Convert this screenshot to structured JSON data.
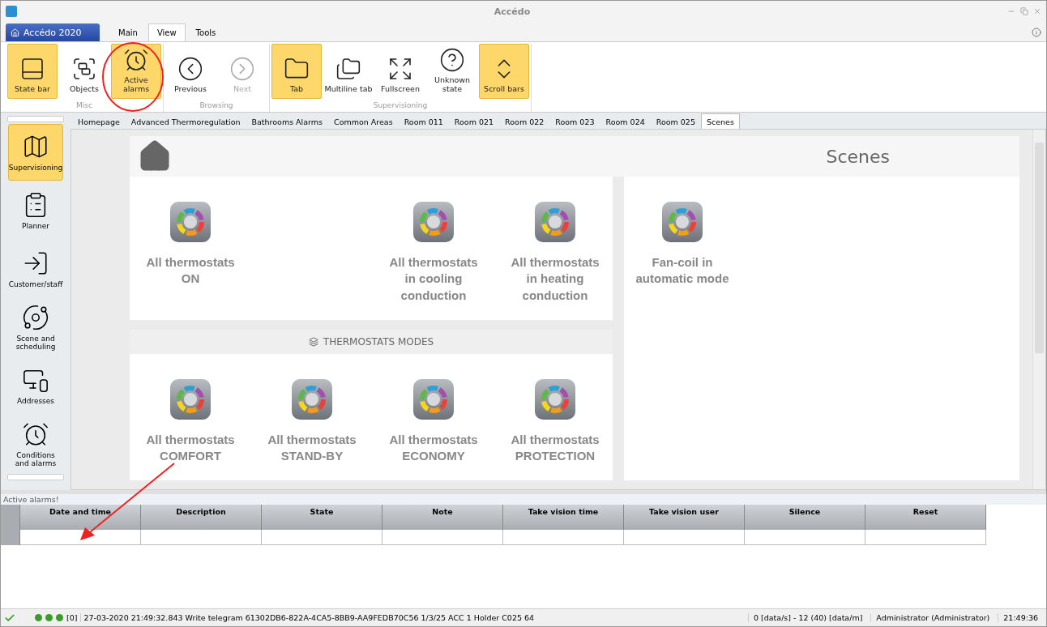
{
  "window": {
    "title": "Accédo"
  },
  "app_menu": {
    "label": "Accédo 2020"
  },
  "ribbon_tabs": [
    {
      "label": "Main",
      "selected": false
    },
    {
      "label": "View",
      "selected": true
    },
    {
      "label": "Tools",
      "selected": false
    }
  ],
  "ribbon_groups": [
    {
      "label": "Misc",
      "buttons": [
        {
          "label": "State bar",
          "selected": true,
          "disabled": false
        },
        {
          "label": "Objects",
          "selected": false,
          "disabled": false
        },
        {
          "label": "Active alarms",
          "selected": true,
          "disabled": false
        }
      ]
    },
    {
      "label": "Browsing",
      "buttons": [
        {
          "label": "Previous",
          "selected": false,
          "disabled": false
        },
        {
          "label": "Next",
          "selected": false,
          "disabled": true
        }
      ]
    },
    {
      "label": "Supervisioning",
      "buttons": [
        {
          "label": "Tab",
          "selected": true,
          "disabled": false
        },
        {
          "label": "Multiline tab",
          "selected": false,
          "disabled": false
        },
        {
          "label": "Fullscreen",
          "selected": false,
          "disabled": false
        },
        {
          "label": "Unknown state",
          "selected": false,
          "disabled": false
        },
        {
          "label": "Scroll bars",
          "selected": true,
          "disabled": false
        }
      ]
    }
  ],
  "sidebar": {
    "items": [
      {
        "label": "Supervisioning",
        "selected": true
      },
      {
        "label": "Planner",
        "selected": false
      },
      {
        "label": "Customer/staff",
        "selected": false
      },
      {
        "label": "Scene and scheduling",
        "selected": false
      },
      {
        "label": "Addresses",
        "selected": false
      },
      {
        "label": "Conditions and alarms",
        "selected": false
      }
    ]
  },
  "doc_tabs": [
    {
      "label": "Homepage",
      "selected": false
    },
    {
      "label": "Advanced Thermoregulation",
      "selected": false
    },
    {
      "label": "Bathrooms Alarms",
      "selected": false
    },
    {
      "label": "Common Areas",
      "selected": false
    },
    {
      "label": "Room 011",
      "selected": false
    },
    {
      "label": "Room 021",
      "selected": false
    },
    {
      "label": "Room 022",
      "selected": false
    },
    {
      "label": "Room 023",
      "selected": false
    },
    {
      "label": "Room 024",
      "selected": false
    },
    {
      "label": "Room 025",
      "selected": false
    },
    {
      "label": "Scenes",
      "selected": true
    }
  ],
  "page": {
    "title": "Scenes",
    "top_scenes": [
      {
        "kind": "scene",
        "label": "All thermostats ON"
      },
      {
        "kind": "blank"
      },
      {
        "kind": "scene",
        "label": "All thermostats in cooling conduction"
      },
      {
        "kind": "scene",
        "label": "All thermostats in heating conduction"
      }
    ],
    "side_scenes": [
      {
        "kind": "scene",
        "label": "Fan-coil in automatic mode"
      }
    ],
    "section_title": "THERMOSTATS MODES",
    "mode_scenes": [
      {
        "kind": "scene",
        "label": "All thermostats COMFORT"
      },
      {
        "kind": "scene",
        "label": "All thermostats STAND-BY"
      },
      {
        "kind": "scene",
        "label": "All thermostats ECONOMY"
      },
      {
        "kind": "scene",
        "label": "All thermostats PROTECTION"
      }
    ]
  },
  "alarms": {
    "title": "Active alarms!",
    "columns": [
      "Date and time",
      "Description",
      "State",
      "Note",
      "Take vision time",
      "Take vision user",
      "Silence",
      "Reset"
    ]
  },
  "status_bar": {
    "count": "[0]",
    "message": "27-03-2020 21:49:32.843 Write telegram 61302DB6-822A-4CA5-8BB9-AA9FEDB70C56 1/3/25 ACC 1 Holder C025 64",
    "rate": "0 [data/s] - 12 (40) [data/m]",
    "user": "Administrator (Administrator)",
    "time": "21:49:36"
  },
  "markup": {
    "circle": true,
    "arrow": true
  }
}
